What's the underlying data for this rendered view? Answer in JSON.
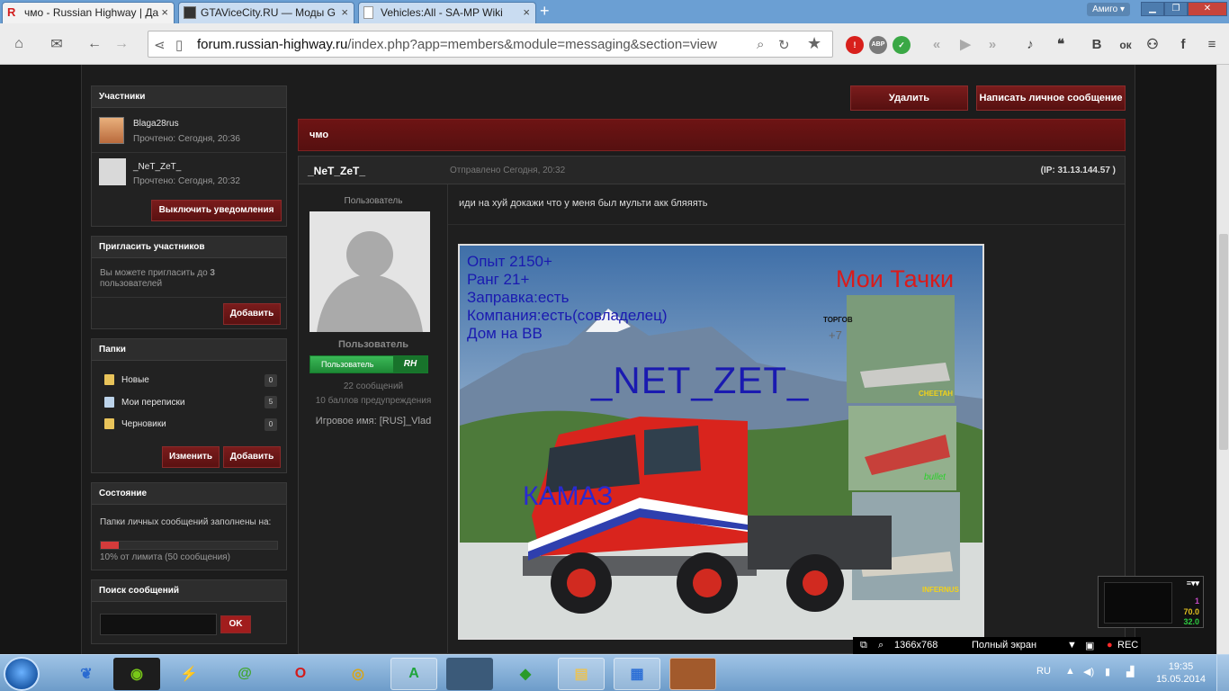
{
  "browser": {
    "tabs": [
      {
        "label": "чмо - Russian Highway | Да",
        "active": true
      },
      {
        "label": "GTAViceCity.RU — Моды G",
        "active": false
      },
      {
        "label": "Vehicles:All - SA-MP Wiki",
        "active": false
      }
    ],
    "new_tab": "+",
    "amigo_label": "Амиго ▾",
    "url_domain": "forum.russian-highway.ru",
    "url_path": "/index.php?app=members&module=messaging&section=view",
    "ext_abp": "ABP",
    "social": [
      "В",
      "ок",
      "f"
    ]
  },
  "sidebar": {
    "participants": {
      "title": "Участники",
      "users": [
        {
          "name": "Blaga28rus",
          "status": "Прочтено: Сегодня, 20:36"
        },
        {
          "name": "_NeT_ZeT_",
          "status": "Прочтено: Сегодня, 20:32"
        }
      ],
      "disable_notif": "Выключить уведомления"
    },
    "invite": {
      "title": "Пригласить участников",
      "text": "Вы можете пригласить до",
      "count": "3",
      "text2": "пользователей",
      "add": "Добавить"
    },
    "folders": {
      "title": "Папки",
      "items": [
        {
          "label": "Новые",
          "count": "0"
        },
        {
          "label": "Мои переписки",
          "count": "5"
        },
        {
          "label": "Черновики",
          "count": "0"
        }
      ],
      "edit": "Изменить",
      "add": "Добавить"
    },
    "status": {
      "title": "Состояние",
      "text": "Папки личных сообщений заполнены на:",
      "fill": 0.1,
      "limit_text": "10% от лимита (50 сообщения)"
    },
    "search": {
      "title": "Поиск сообщений",
      "ok": "OK"
    }
  },
  "main": {
    "delete_btn": "Удалить",
    "write_btn": "Написать личное сообщение",
    "topic_title": "чмо",
    "message": {
      "author": "_NeT_ZeT_",
      "sent": "Отправлено Сегодня, 20:32",
      "ip": "(IP: 31.13.144.57 )",
      "text": "иди на хуй докажи что у меня был мульти акк бляяять"
    },
    "user": {
      "role_top": "Пользователь",
      "role_name": "Пользователь",
      "group_label": "Пользователь",
      "group_tag": "RH",
      "posts": "22 сообщений",
      "warnings": "10 баллов предупреждения",
      "game_name": "Игровое имя: [RUS]_Vlad"
    },
    "image": {
      "lines": [
        "Опыт 2150+",
        "Ранг 21+",
        "Заправка:есть",
        "Компания:есть(совладелец)",
        "Дом на ВВ"
      ],
      "title": "Мои Тачки",
      "name": "_NET_ZET_",
      "brand": "КАМАЗ",
      "car1": "CHEETAH",
      "car2": "bullet",
      "car3": "INFERNUS",
      "small": "ТОРГОВ",
      "small2": "+7"
    }
  },
  "recorder": {
    "fps_values": [
      "1",
      "70.0",
      "32.0"
    ],
    "resolution": "1366x768",
    "mode": "Полный экран",
    "rec": "REC"
  },
  "taskbar": {
    "lang": "RU",
    "time": "19:35",
    "date": "15.05.2014"
  }
}
